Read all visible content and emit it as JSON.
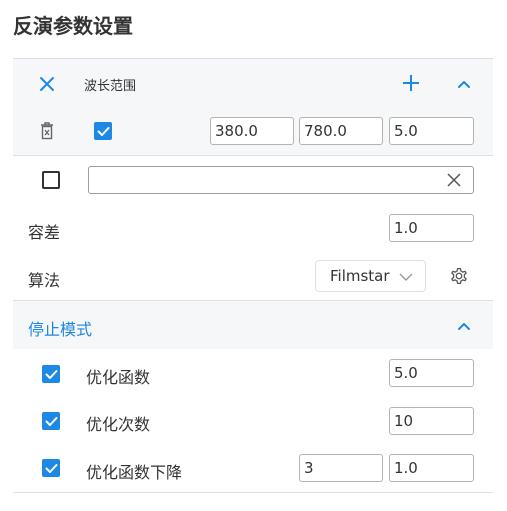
{
  "page": {
    "title": "反演参数设置"
  },
  "wavelength": {
    "label": "波长范围",
    "start": "380.0",
    "end": "780.0",
    "step": "5.0",
    "enabled": true
  },
  "filter": {
    "enabled": false,
    "value": ""
  },
  "tolerance": {
    "label": "容差",
    "value": "1.0"
  },
  "algorithm": {
    "label": "算法",
    "selected": "Filmstar"
  },
  "stop_mode": {
    "title": "停止模式",
    "items": [
      {
        "label": "优化函数",
        "checked": true,
        "value": "5.0"
      },
      {
        "label": "优化次数",
        "checked": true,
        "value": "10"
      },
      {
        "label": "优化函数下降",
        "checked": true,
        "value1": "3",
        "value2": "1.0"
      }
    ]
  },
  "colors": {
    "accent": "#1e88e5",
    "band": "#f6f7f9",
    "divider": "#dcdfe6",
    "text": "#333333"
  },
  "icons": {
    "remove": "close-icon",
    "add": "plus-icon",
    "collapse": "chevron-up-icon",
    "delete": "trash-icon",
    "clear": "clear-icon",
    "dropdown": "chevron-down-icon",
    "settings": "gear-icon"
  }
}
